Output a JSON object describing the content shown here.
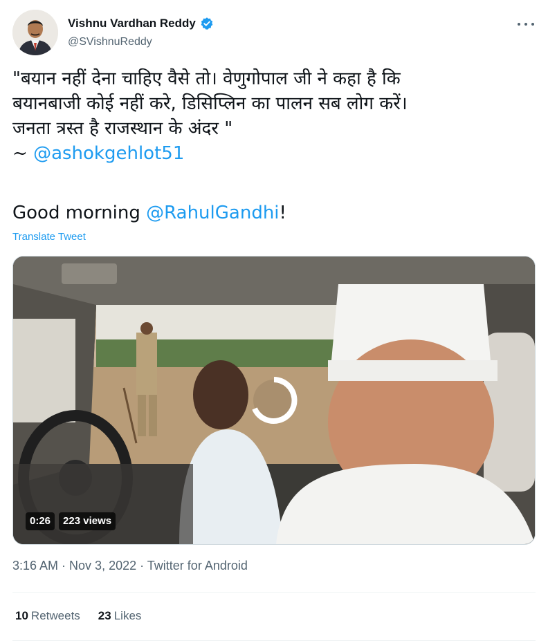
{
  "author": {
    "name": "Vishnu Vardhan Reddy",
    "handle": "@SVishnuReddy",
    "verified_color": "#1d9bf0"
  },
  "tweet": {
    "line1": "\"बयान नहीं देना चाहिए वैसे तो। वेणुगोपाल जी ने कहा है कि",
    "line2": "बयानबाजी कोई नहीं करे, डिसिप्लिन का पालन सब लोग करें।",
    "line3": "जनता त्रस्त है राजस्थान के अंदर \"",
    "line4_prefix": "~ ",
    "line4_mention": "@ashokgehlot51",
    "greeting_prefix": "Good morning ",
    "greeting_mention": "@RahulGandhi",
    "greeting_suffix": "!",
    "translate_label": "Translate Tweet"
  },
  "video": {
    "duration": "0:26",
    "views": "223 views"
  },
  "meta": {
    "time": "3:16 AM",
    "date": "Nov 3, 2022",
    "source": "Twitter for Android",
    "separator": " · "
  },
  "stats": {
    "retweets_count": "10",
    "retweets_label": "Retweets",
    "likes_count": "23",
    "likes_label": "Likes"
  },
  "icons": {
    "more": "more-horizontal-icon",
    "verified": "verified-badge-icon",
    "spinner": "loading-spinner-icon"
  },
  "colors": {
    "link": "#1d9bf0",
    "text": "#0f1419",
    "secondary": "#536471"
  }
}
